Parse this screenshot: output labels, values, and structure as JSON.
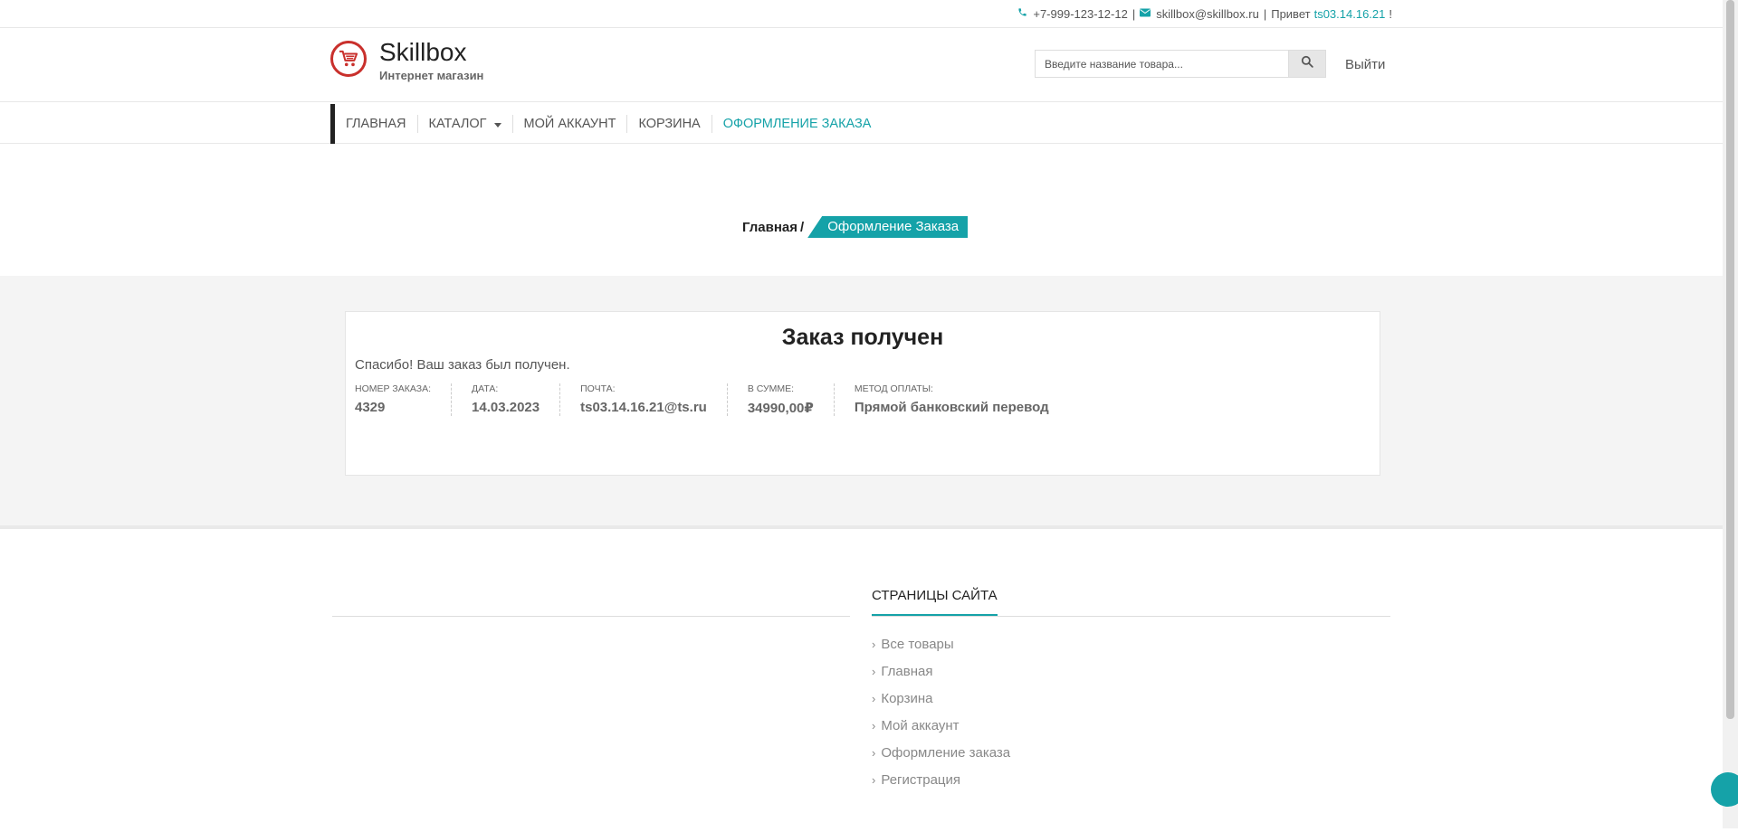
{
  "topbar": {
    "phone": "+7-999-123-12-12",
    "separator": "|",
    "email": "skillbox@skillbox.ru",
    "greeting": "Привет",
    "username": "ts03.14.16.21",
    "exclamation": "!"
  },
  "header": {
    "logo_title": "Skillbox",
    "logo_subtitle": "Интернет магазин",
    "search_placeholder": "Введите название товара...",
    "logout_label": "Выйти"
  },
  "nav": {
    "items": [
      {
        "label": "ГЛАВНАЯ"
      },
      {
        "label": "КАТАЛОГ"
      },
      {
        "label": "МОЙ АККАУНТ"
      },
      {
        "label": "КОРЗИНА"
      },
      {
        "label": "ОФОРМЛЕНИЕ ЗАКАЗА"
      }
    ]
  },
  "breadcrumb": {
    "home": "Главная",
    "slash": "/",
    "current": "Оформление Заказа"
  },
  "order": {
    "title": "Заказ получен",
    "thanks": "Спасибо! Ваш заказ был получен.",
    "details": [
      {
        "label": "НОМЕР ЗАКАЗА:",
        "value": "4329"
      },
      {
        "label": "ДАТА:",
        "value": "14.03.2023"
      },
      {
        "label": "ПОЧТА:",
        "value": "ts03.14.16.21@ts.ru"
      },
      {
        "label": "В СУММЕ:",
        "value": "34990,00₽"
      },
      {
        "label": "МЕТОД ОПЛАТЫ:",
        "value": "Прямой банковский перевод"
      }
    ]
  },
  "footer": {
    "pages_title": "СТРАНИЦЫ САЙТА",
    "links": [
      {
        "label": "Все товары"
      },
      {
        "label": "Главная"
      },
      {
        "label": "Корзина"
      },
      {
        "label": "Мой аккаунт"
      },
      {
        "label": "Оформление заказа"
      },
      {
        "label": "Регистрация"
      }
    ]
  },
  "icons": {
    "phone": "phone-icon",
    "email": "envelope-icon",
    "search": "search-icon",
    "cart": "cart-icon",
    "chevron": "chevron-right-icon"
  },
  "colors": {
    "accent": "#15a2a8",
    "logo_red": "#c9302c",
    "gray_bg": "#f4f4f4"
  }
}
